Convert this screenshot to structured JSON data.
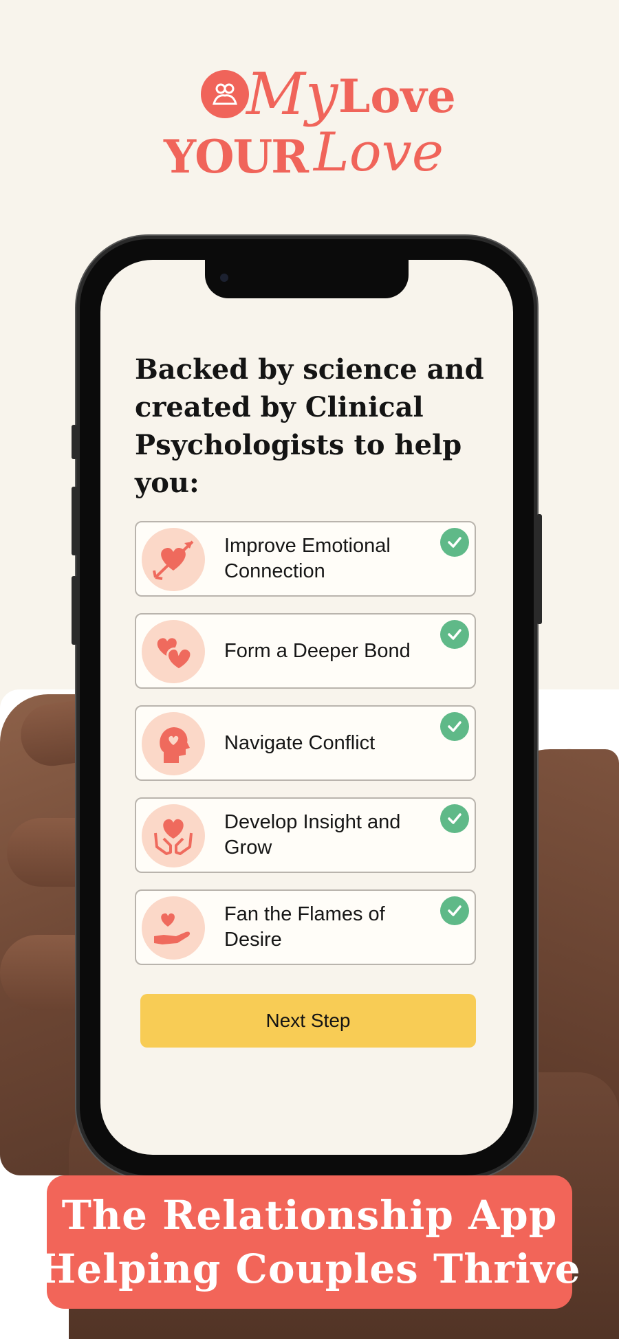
{
  "logo": {
    "line1_a": "My",
    "line1_b": "Love",
    "line2_a": "YOUR",
    "line2_b": "Love",
    "badge_icon": "couple-icon"
  },
  "screen": {
    "headline": "Backed by science and created by Clinical Psychologists to help you:",
    "goals": [
      {
        "label": "Improve Emotional Connection",
        "icon": "heart-arrow-icon",
        "checked": true
      },
      {
        "label": "Form a Deeper Bond",
        "icon": "two-hearts-icon",
        "checked": true
      },
      {
        "label": "Navigate Conflict",
        "icon": "head-heart-icon",
        "checked": true
      },
      {
        "label": "Develop Insight and Grow",
        "icon": "hands-heart-icon",
        "checked": true
      },
      {
        "label": "Fan the Flames of Desire",
        "icon": "hand-heart-icon",
        "checked": true
      }
    ],
    "next_button": "Next Step"
  },
  "banner": {
    "line1": "The Relationship App",
    "line2": "Helping Couples Thrive"
  },
  "colors": {
    "brand": "#f0645a",
    "background": "#f8f4ec",
    "check": "#5fb988",
    "button": "#f8cc55",
    "icon_bg": "#fbd8c8"
  }
}
